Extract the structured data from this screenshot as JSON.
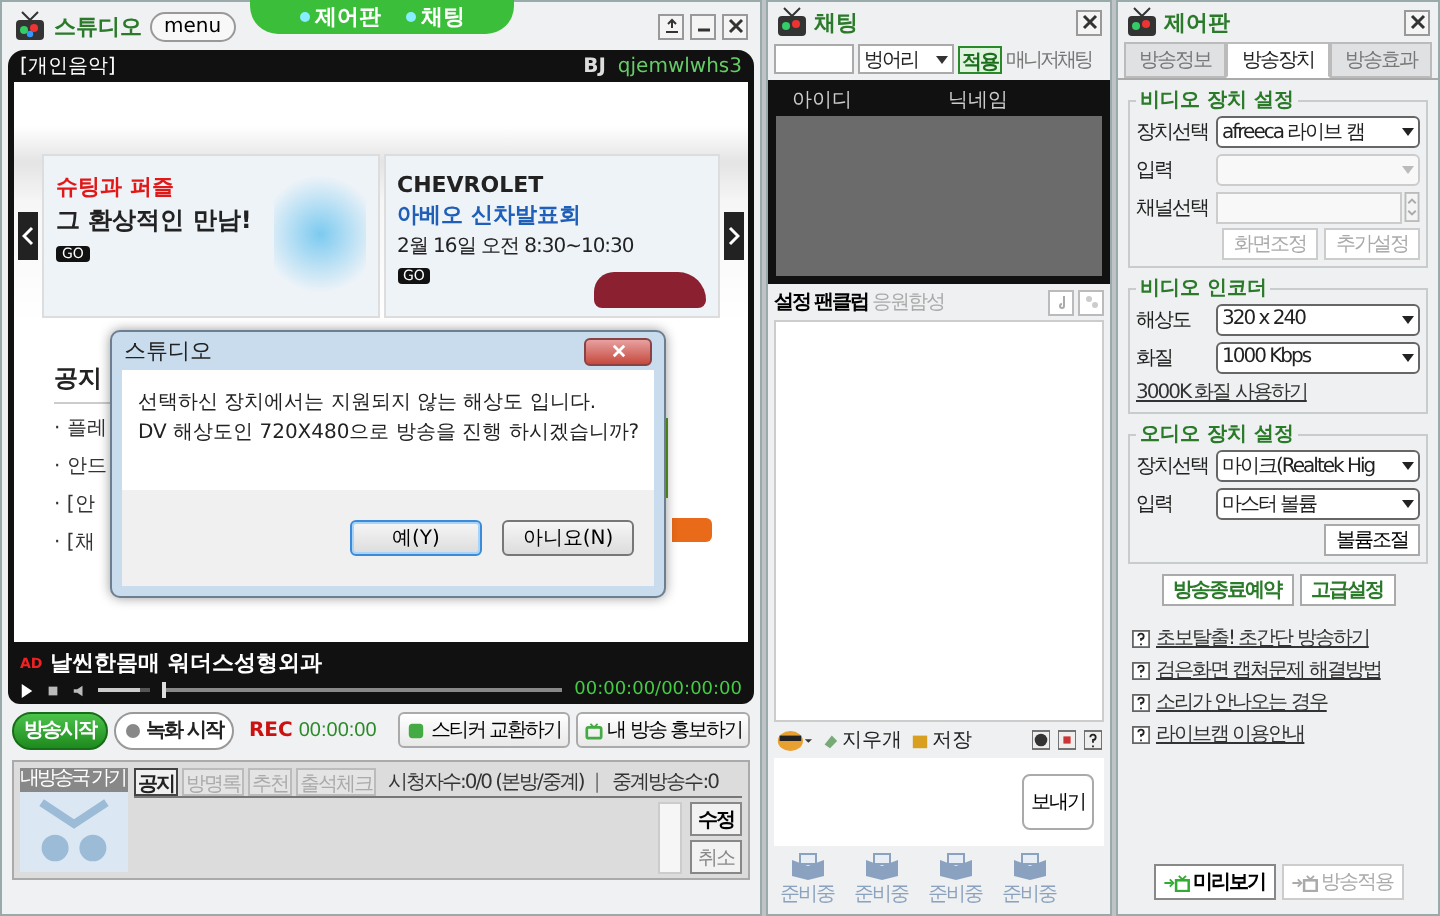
{
  "studio": {
    "title": "스튜디오",
    "menu_button": "menu",
    "top_tabs": [
      {
        "label": "제어판"
      },
      {
        "label": "채팅"
      }
    ],
    "category": "[개인음악]",
    "bj_label": "BJ",
    "bj_id": "qjemwlwhs3",
    "banners": [
      {
        "lines": [
          {
            "text": "슈팅과 퍼즐",
            "kind": "accent",
            "color": "#e01818"
          },
          {
            "text": "그 환상적인 만남!",
            "kind": "plain"
          }
        ],
        "go": "GO"
      },
      {
        "lines": [
          {
            "text": "CHEVROLET",
            "kind": "brand"
          },
          {
            "text": "아베오 신차발표회",
            "kind": "accent",
            "color": "#1f5fb8"
          },
          {
            "text": "2월 16일 오전 8:30~10:30",
            "kind": "small"
          }
        ],
        "go": "GO"
      }
    ],
    "notice": {
      "title": "공지",
      "items": [
        "· 플레",
        "· 안드",
        "· [안",
        "· [채"
      ]
    },
    "video_bar": {
      "ad_badge": "AD",
      "caption": "날씬한몸매 워더스성형외과",
      "volume": {
        "level": 0.8
      },
      "seek": {
        "level": 0
      },
      "time": "00:00:00/00:00:00"
    },
    "controls": {
      "start_button": "방송시작",
      "record_button": "녹화 시작",
      "rec_label": "REC",
      "rec_time": "00:00:00",
      "sticker_button": "스티커 교환하기",
      "promo_button": "내 방송 홍보하기"
    },
    "board": {
      "home_link": "내방송국 가기",
      "tabs": [
        {
          "label": "공지",
          "selected": true,
          "disabled": false
        },
        {
          "label": "방명록",
          "selected": false,
          "disabled": true
        },
        {
          "label": "추천",
          "selected": false,
          "disabled": true
        },
        {
          "label": "출석체크",
          "selected": false,
          "disabled": true
        }
      ],
      "viewers": "시청자수:0/0 (본방/중계)",
      "separator": "|",
      "relays": "중계방송수:0",
      "edit_button": "수정",
      "cancel_button": "취소"
    }
  },
  "dialog": {
    "title": "스튜디오",
    "message": [
      "선택하신 장치에서는 지원되지 않는 해상도 입니다.",
      "DV 해상도인 720X480으로 방송을 진행 하시겠습니까?"
    ],
    "buttons": [
      {
        "label": "예(Y)",
        "selected": true
      },
      {
        "label": "아니요(N)",
        "selected": false
      }
    ]
  },
  "chat": {
    "title": "채팅",
    "filter_option": "벙어리",
    "apply_button": "적용",
    "manager_chat": "매니저채팅",
    "user_columns": [
      "아이디",
      "닉네임"
    ],
    "toolbar": [
      {
        "label": "설정",
        "disabled": false
      },
      {
        "label": "팬클럽",
        "disabled": false
      },
      {
        "label": "응원함성",
        "disabled": true
      }
    ],
    "eraser": "지우개",
    "save": "저장",
    "send_button": "보내기",
    "gifts": [
      "준비중",
      "준비중",
      "준비중",
      "준비중"
    ]
  },
  "control": {
    "title": "제어판",
    "tabs": [
      {
        "label": "방송정보",
        "selected": false
      },
      {
        "label": "방송장치",
        "selected": true
      },
      {
        "label": "방송효과",
        "selected": false
      }
    ],
    "groups": [
      {
        "title": "비디오 장치 설정",
        "fields": [
          {
            "kind": "select",
            "label": "장치선택",
            "value": "afreeca 라이브 캠",
            "disabled": false
          },
          {
            "kind": "select",
            "label": "입력",
            "disabled": true
          },
          {
            "kind": "spinner",
            "label": "채널선택",
            "disabled": true
          }
        ],
        "buttons": [
          {
            "label": "화면조정",
            "disabled": true
          },
          {
            "label": "추가설정",
            "disabled": true
          }
        ]
      },
      {
        "title": "비디오 인코더",
        "fields": [
          {
            "kind": "select",
            "label": "해상도",
            "value": "320 x 240",
            "disabled": false
          },
          {
            "kind": "select",
            "label": "화질",
            "value": "1000 Kbps",
            "disabled": false
          }
        ],
        "link": "3000K 화질 사용하기"
      },
      {
        "title": "오디오 장치 설정",
        "fields": [
          {
            "kind": "select",
            "label": "장치선택",
            "value": "마이크(Realtek Hig",
            "disabled": false
          },
          {
            "kind": "select",
            "label": "입력",
            "value": "마스터 볼륨",
            "disabled": false
          }
        ],
        "buttons": [
          {
            "label": "볼륨조절",
            "disabled": false
          }
        ]
      }
    ],
    "actions": [
      "방송종료예약",
      "고급설정"
    ],
    "help_links": [
      "초보탈출! 초간단 방송하기",
      "검은화면 캡쳐문제 해결방법",
      "소리가 안나오는 경우",
      "라이브캠 이용안내"
    ],
    "bottom_buttons": [
      {
        "label": "미리보기",
        "disabled": false
      },
      {
        "label": "방송적용",
        "disabled": true
      }
    ]
  }
}
